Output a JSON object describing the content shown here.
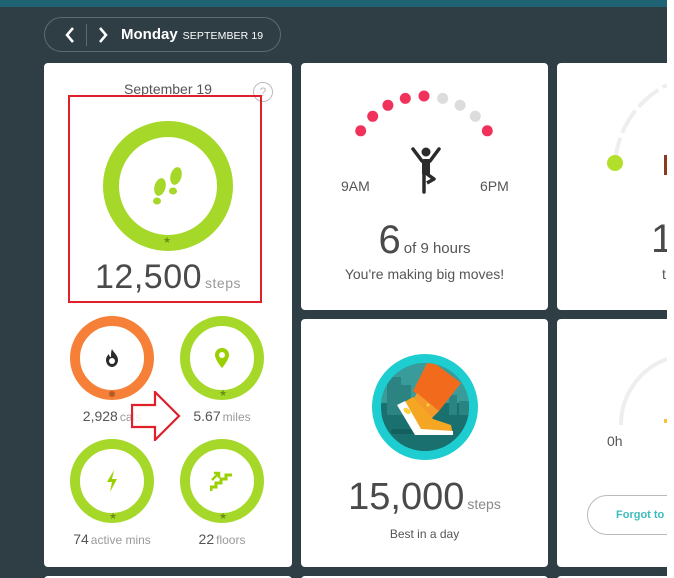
{
  "nav": {
    "prev_icon": "chevron-left-icon",
    "next_icon": "chevron-right-icon",
    "day": "Monday",
    "date": "SEPTEMBER 19"
  },
  "today": {
    "date": "September 19",
    "help": "?",
    "steps": {
      "value": "12,500",
      "unit": "steps",
      "icon": "footprints-icon",
      "goal_met": true,
      "color": "#a6d82a"
    },
    "calories": {
      "value": "2,928",
      "unit": "cals",
      "icon": "flame-icon",
      "goal_met": false,
      "color": "#f68038"
    },
    "distance": {
      "value": "5.67",
      "unit": "miles",
      "icon": "location-pin-icon",
      "goal_met": true,
      "color": "#a6d82a"
    },
    "active": {
      "value": "74",
      "unit": "active mins",
      "icon": "lightning-icon",
      "goal_met": true,
      "color": "#a6d82a"
    },
    "floors": {
      "value": "22",
      "unit": "floors",
      "icon": "stairs-icon",
      "goal_met": true,
      "color": "#a6d82a"
    }
  },
  "hourly": {
    "start_label": "9AM",
    "end_label": "6PM",
    "hours_met": [
      true,
      true,
      true,
      true,
      true,
      false,
      false,
      false,
      true
    ],
    "count": "6",
    "count_suffix": "of 9 hours",
    "message": "You're making big moves!",
    "active_color": "#f0325a",
    "inactive_color": "#dcdcdc",
    "icon": "person-tree-pose-icon"
  },
  "badge": {
    "value": "15,000",
    "unit": "steps",
    "caption": "Best in a day",
    "icon": "sneaker-badge-icon"
  },
  "right_cards": {
    "partial_value": "1",
    "partial_caption": "t",
    "zero_label": "0h",
    "forgot_button": "Forgot to"
  },
  "annotation": {
    "highlight_color": "#e0202a"
  }
}
